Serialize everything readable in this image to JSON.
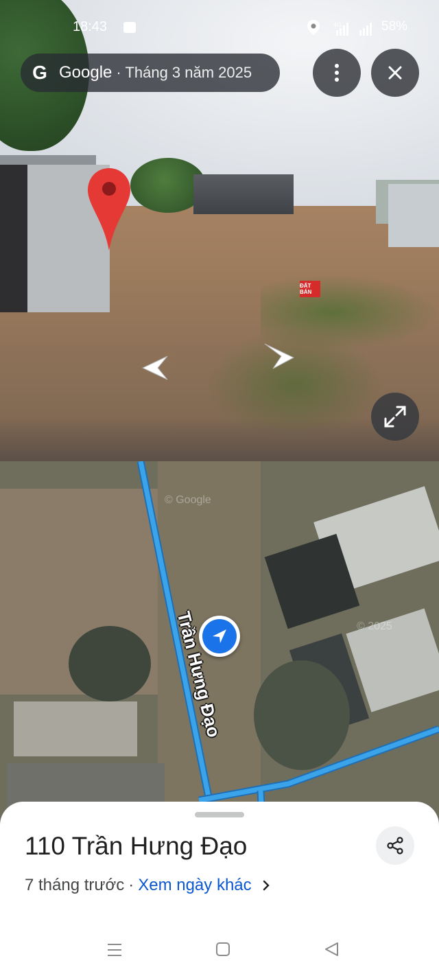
{
  "status_bar": {
    "time": "18:43",
    "battery": "58%"
  },
  "street_view": {
    "brand": "Google",
    "separator": "·",
    "capture_date": "Tháng 3 năm 2025",
    "sign_text": "ĐẤT BÁN",
    "buttons": {
      "menu_icon": "vertical-dots",
      "close_icon": "close-x",
      "expand_icon": "diagonal-expand-arrows"
    }
  },
  "map": {
    "road_label": "Trần Hưng Đạo",
    "watermark_1": "© Google",
    "watermark_2": "© 2025"
  },
  "place": {
    "title": "110 Trần Hưng Đạo",
    "age": "7 tháng trước",
    "separator": "·",
    "other_dates_link": "Xem ngày khác"
  },
  "colors": {
    "accent_blue": "#1a73e8",
    "road_blue": "#3ba3ea",
    "pin_red": "#e53935",
    "link_blue": "#0b57d0"
  }
}
